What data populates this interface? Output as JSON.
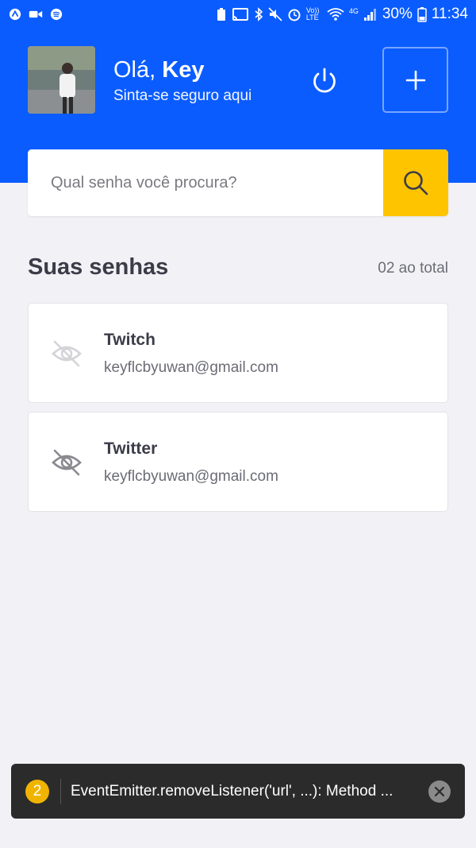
{
  "status_bar": {
    "battery": "30%",
    "time": "11:34",
    "network": "4G",
    "volte": "Vo)) LTE"
  },
  "header": {
    "greeting_prefix": "Olá, ",
    "user_name": "Key",
    "subtitle": "Sinta-se seguro aqui",
    "colors": {
      "background": "#0a5cff",
      "text": "#ffffff"
    }
  },
  "search": {
    "placeholder": "Qual senha você procura?",
    "button_color": "#ffc400"
  },
  "passwords": {
    "title": "Suas senhas",
    "count_label": "02 ao total",
    "items": [
      {
        "name": "Twitch",
        "email": "keyflcbyuwan@gmail.com",
        "icon": "eye-off-icon"
      },
      {
        "name": "Twitter",
        "email": "keyflcbyuwan@gmail.com",
        "icon": "eye-off-icon"
      }
    ]
  },
  "toast": {
    "badge": "2",
    "message": "EventEmitter.removeListener('url', ...): Method ..."
  }
}
